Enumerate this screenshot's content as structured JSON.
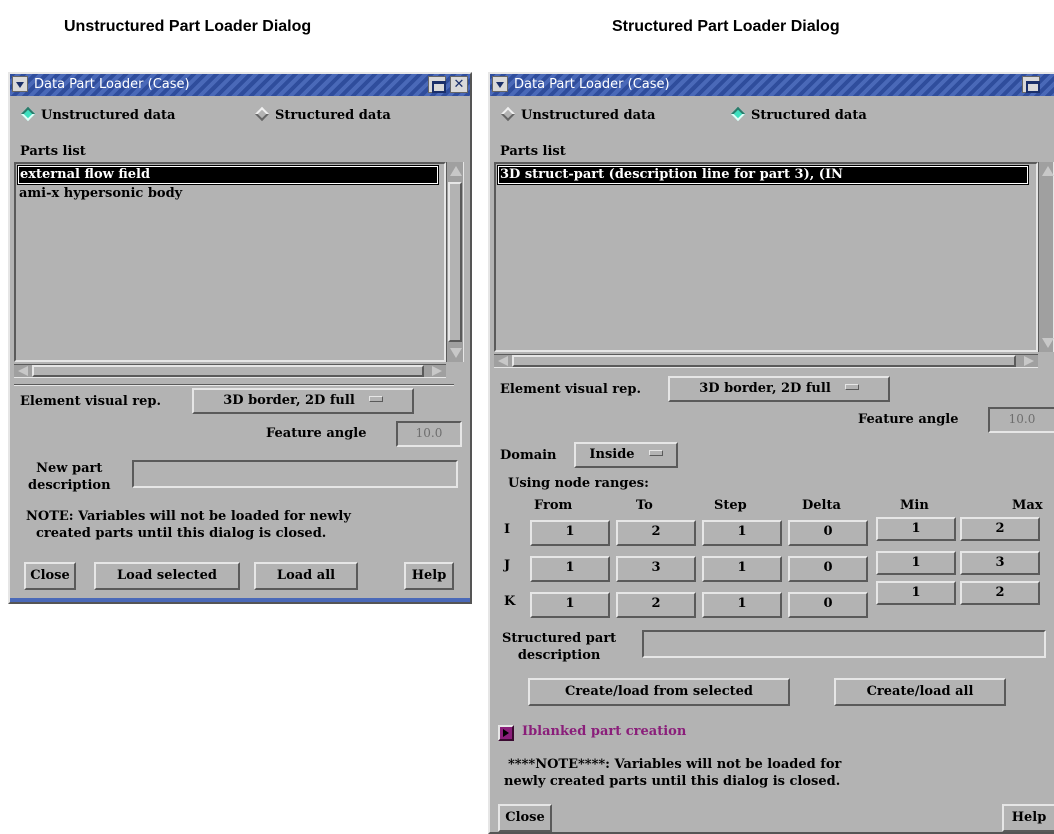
{
  "captions": {
    "left": "Unstructured Part Loader Dialog",
    "right": "Structured Part Loader Dialog"
  },
  "unstructured": {
    "title": "Data Part Loader (Case)",
    "radio_unstructured": "Unstructured data",
    "radio_structured": "Structured data",
    "selected_mode": "unstructured",
    "parts_list_label": "Parts list",
    "parts": [
      "external flow field",
      "ami-x hypersonic body"
    ],
    "selected_part_index": 0,
    "element_visual_rep_label": "Element visual rep.",
    "element_visual_rep_value": "3D border, 2D full",
    "feature_angle_label": "Feature angle",
    "feature_angle_value": "10.0",
    "new_part_label_line1": "New part",
    "new_part_label_line2": "description",
    "new_part_value": "",
    "note_line1": "NOTE: Variables will not be loaded for newly",
    "note_line2": "created parts until this dialog is closed.",
    "buttons": {
      "close": "Close",
      "load_selected": "Load selected",
      "load_all": "Load all",
      "help": "Help"
    }
  },
  "structured": {
    "title": "Data Part Loader (Case)",
    "radio_unstructured": "Unstructured data",
    "radio_structured": "Structured data",
    "selected_mode": "structured",
    "parts_list_label": "Parts list",
    "parts": [
      "3D struct-part (description line for part 3), (IN"
    ],
    "selected_part_index": 0,
    "element_visual_rep_label": "Element visual rep.",
    "element_visual_rep_value": "3D border, 2D full",
    "feature_angle_label": "Feature angle",
    "feature_angle_value": "10.0",
    "domain_label": "Domain",
    "domain_value": "Inside",
    "node_ranges_label": "Using node ranges:",
    "columns": {
      "from": "From",
      "to": "To",
      "step": "Step",
      "delta": "Delta",
      "min": "Min",
      "max": "Max"
    },
    "rows": [
      {
        "axis": "I",
        "from": "1",
        "to": "2",
        "step": "1",
        "delta": "0",
        "min": "1",
        "max": "2"
      },
      {
        "axis": "J",
        "from": "1",
        "to": "3",
        "step": "1",
        "delta": "0",
        "min": "1",
        "max": "3"
      },
      {
        "axis": "K",
        "from": "1",
        "to": "2",
        "step": "1",
        "delta": "0",
        "min": "1",
        "max": "2"
      }
    ],
    "struct_desc_label_line1": "Structured part",
    "struct_desc_label_line2": "description",
    "struct_desc_value": "",
    "create_selected": "Create/load from selected",
    "create_all": "Create/load all",
    "iblanked": "Iblanked part creation",
    "note_line1": "****NOTE****: Variables will not be loaded for",
    "note_line2": "newly created parts until this dialog is closed.",
    "buttons": {
      "close": "Close",
      "help": "Help"
    }
  },
  "colors": {
    "dialog_bg": "#b3b3b3",
    "titlebar": "#2f4d9c",
    "radio_on": "#3ddfbf",
    "iblanked_text": "#8a1e7a"
  }
}
